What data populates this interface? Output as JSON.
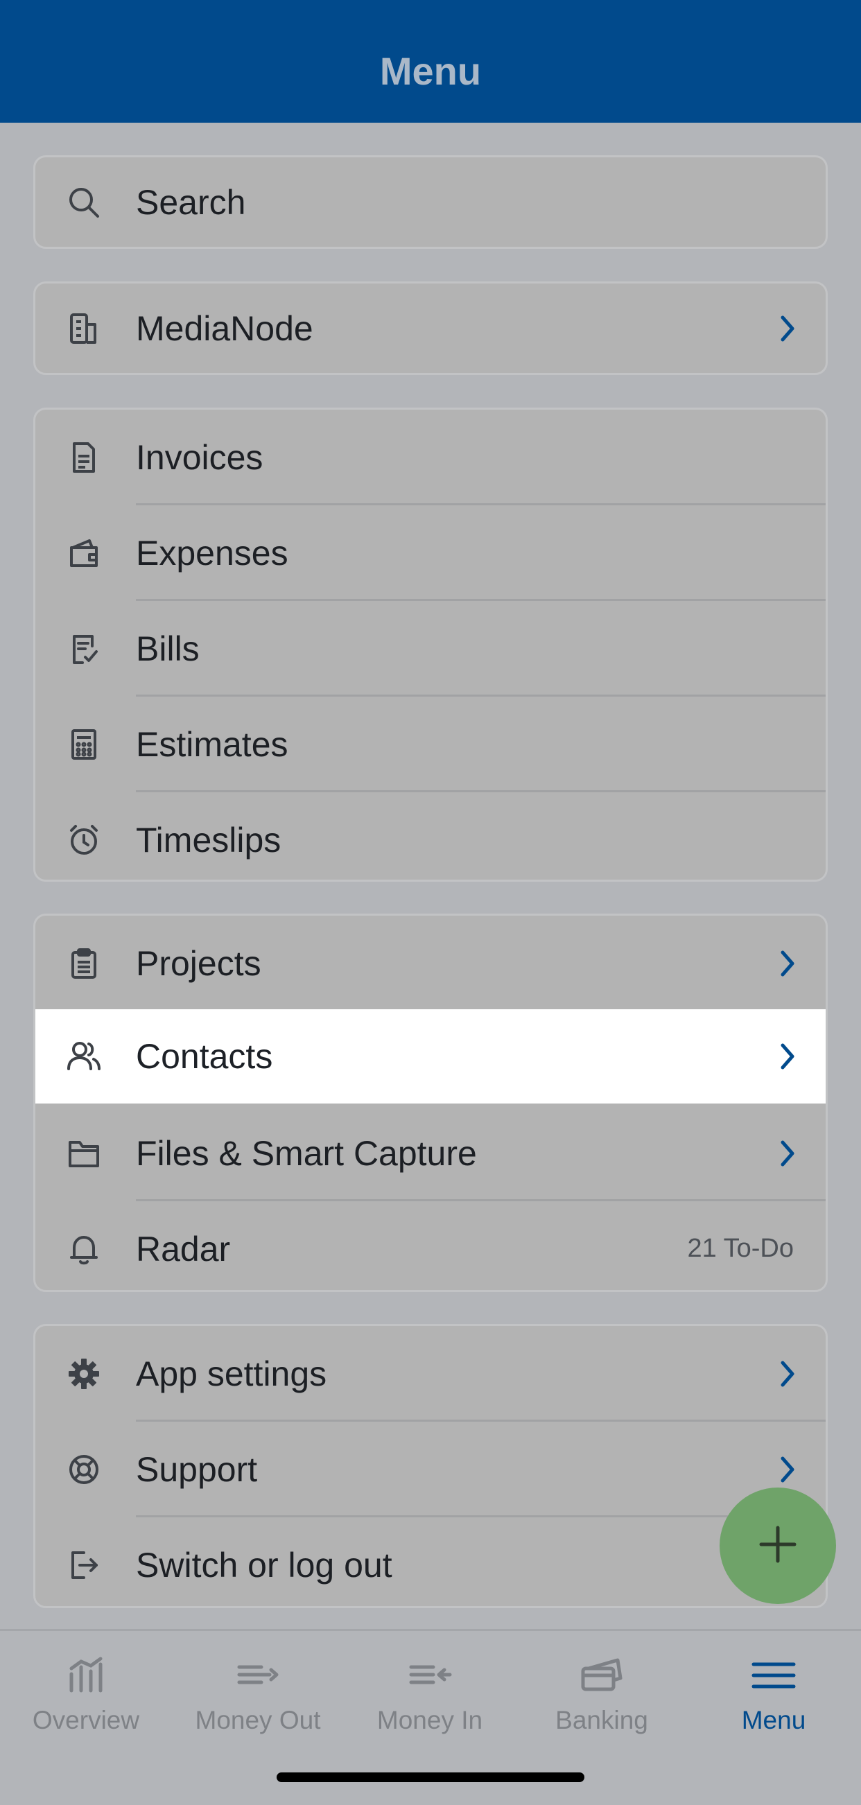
{
  "header": {
    "title": "Menu"
  },
  "search": {
    "placeholder": "Search"
  },
  "company": {
    "name": "MediaNode"
  },
  "group1": [
    {
      "label": "Invoices",
      "icon": "invoice-icon"
    },
    {
      "label": "Expenses",
      "icon": "wallet-icon"
    },
    {
      "label": "Bills",
      "icon": "bill-icon"
    },
    {
      "label": "Estimates",
      "icon": "calculator-icon"
    },
    {
      "label": "Timeslips",
      "icon": "alarm-clock-icon"
    }
  ],
  "group2": [
    {
      "label": "Projects",
      "icon": "clipboard-icon"
    },
    {
      "label": "Contacts",
      "icon": "contacts-icon"
    },
    {
      "label": "Files & Smart Capture",
      "icon": "folder-icon"
    },
    {
      "label": "Radar",
      "icon": "bell-icon",
      "badge": "21 To-Do"
    }
  ],
  "group3": [
    {
      "label": "App settings",
      "icon": "gear-icon"
    },
    {
      "label": "Support",
      "icon": "lifebuoy-icon"
    },
    {
      "label": "Switch or log out",
      "icon": "logout-icon"
    }
  ],
  "tabs": [
    {
      "label": "Overview",
      "icon": "chart-icon"
    },
    {
      "label": "Money Out",
      "icon": "money-out-icon"
    },
    {
      "label": "Money In",
      "icon": "money-in-icon"
    },
    {
      "label": "Banking",
      "icon": "bank-cards-icon"
    },
    {
      "label": "Menu",
      "icon": "hamburger-icon"
    }
  ],
  "colors": {
    "header": "#014a8c",
    "accent": "#014a8c",
    "fab": "#6fa369",
    "overlay": "#b3b5b9"
  }
}
